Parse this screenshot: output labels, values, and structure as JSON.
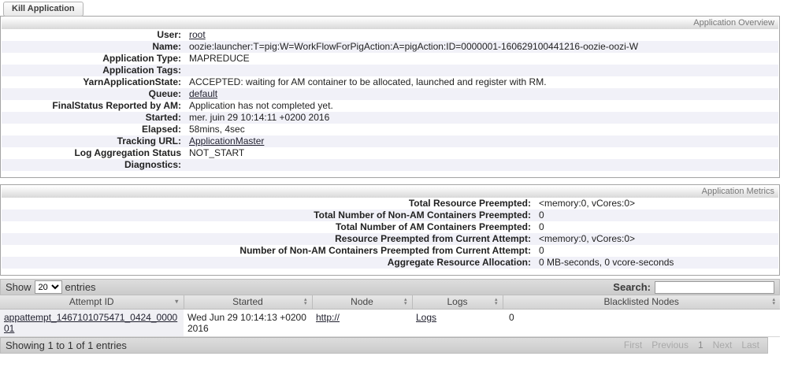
{
  "kill_button": "Kill Application",
  "overview": {
    "header": "Application Overview",
    "rows": [
      {
        "label": "User:",
        "value": "root"
      },
      {
        "label": "Name:",
        "value": "oozie:launcher:T=pig:W=WorkFlowForPigAction:A=pigAction:ID=0000001-160629100441216-oozie-oozi-W"
      },
      {
        "label": "Application Type:",
        "value": "MAPREDUCE"
      },
      {
        "label": "Application Tags:",
        "value": ""
      },
      {
        "label": "YarnApplicationState:",
        "value": "ACCEPTED: waiting for AM container to be allocated, launched and register with RM."
      },
      {
        "label": "Queue:",
        "value": "default"
      },
      {
        "label": "FinalStatus Reported by AM:",
        "value": "Application has not completed yet."
      },
      {
        "label": "Started:",
        "value": "mer. juin 29 10:14:11 +0200 2016"
      },
      {
        "label": "Elapsed:",
        "value": "58mins, 4sec"
      },
      {
        "label": "Tracking URL:",
        "value": "ApplicationMaster"
      },
      {
        "label": "Log Aggregation Status",
        "value": "NOT_START"
      },
      {
        "label": "Diagnostics:",
        "value": ""
      }
    ]
  },
  "metrics": {
    "header": "Application Metrics",
    "rows": [
      {
        "label": "Total Resource Preempted:",
        "value": "<memory:0, vCores:0>"
      },
      {
        "label": "Total Number of Non-AM Containers Preempted:",
        "value": "0"
      },
      {
        "label": "Total Number of AM Containers Preempted:",
        "value": "0"
      },
      {
        "label": "Resource Preempted from Current Attempt:",
        "value": "<memory:0, vCores:0>"
      },
      {
        "label": "Number of Non-AM Containers Preempted from Current Attempt:",
        "value": "0"
      },
      {
        "label": "Aggregate Resource Allocation:",
        "value": "0 MB-seconds, 0 vcore-seconds"
      }
    ]
  },
  "table": {
    "show_label": "Show",
    "page_size": "20",
    "entries_label": "entries",
    "search_label": "Search:",
    "columns": [
      "Attempt ID",
      "Started",
      "Node",
      "Logs",
      "Blacklisted Nodes"
    ],
    "row": {
      "attempt_id": "appattempt_1467101075471_0424_000001",
      "started": "Wed Jun 29 10:14:13 +0200 2016",
      "node": "http://",
      "logs": "Logs",
      "blacklisted": "0"
    },
    "footer_status": "Showing 1 to 1 of 1 entries",
    "pagination": [
      "First",
      "Previous",
      "1",
      "Next",
      "Last"
    ]
  }
}
